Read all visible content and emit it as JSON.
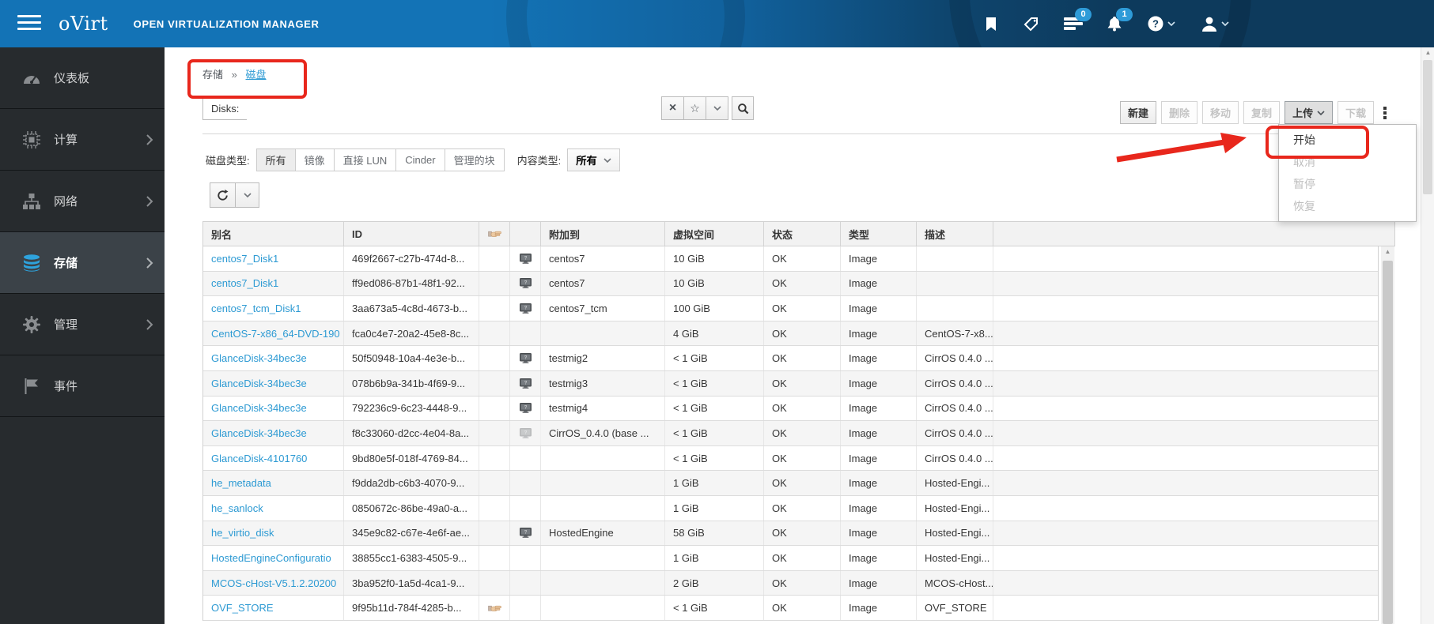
{
  "masthead": {
    "brand": "oVirt",
    "brand_suffix": "OPEN VIRTUALIZATION MANAGER",
    "tasks_badge": "0",
    "alerts_badge": "1"
  },
  "sidebar": {
    "items": [
      {
        "label": "仪表板",
        "icon": "dashboard",
        "chevron": false,
        "active": false
      },
      {
        "label": "计算",
        "icon": "cpu",
        "chevron": true,
        "active": false
      },
      {
        "label": "网络",
        "icon": "network",
        "chevron": true,
        "active": false
      },
      {
        "label": "存储",
        "icon": "storage",
        "chevron": true,
        "active": true
      },
      {
        "label": "管理",
        "icon": "gear",
        "chevron": true,
        "active": false
      },
      {
        "label": "事件",
        "icon": "flag",
        "chevron": false,
        "active": false
      }
    ]
  },
  "breadcrumb": {
    "parent": "存储",
    "separator": "»",
    "current": "磁盘"
  },
  "search": {
    "label": "Disks:",
    "value": ""
  },
  "actions": {
    "new": "新建",
    "remove": "删除",
    "move": "移动",
    "copy": "复制",
    "upload": "上传",
    "download": "下载"
  },
  "upload_menu": {
    "items": [
      {
        "label": "开始",
        "enabled": true
      },
      {
        "label": "取消",
        "enabled": false
      },
      {
        "label": "暂停",
        "enabled": false
      },
      {
        "label": "恢复",
        "enabled": false
      }
    ]
  },
  "filters": {
    "disk_type_label": "磁盘类型:",
    "disk_types": [
      "所有",
      "镜像",
      "直接 LUN",
      "Cinder",
      "管理的块"
    ],
    "active_disk_type": "所有",
    "content_type_label": "内容类型:",
    "content_type_value": "所有"
  },
  "table": {
    "headers": {
      "alias": "别名",
      "id": "ID",
      "attached_to": "附加到",
      "virtual_size": "虚拟空间",
      "status": "状态",
      "type": "类型",
      "description": "描述"
    },
    "rows": [
      {
        "alias": "centos7_Disk1",
        "id": "469f2667-c27b-474d-8...",
        "shareable": false,
        "vm_icon": "vm",
        "attached_to": "centos7",
        "virtual_size": "10 GiB",
        "status": "OK",
        "type": "Image",
        "description": ""
      },
      {
        "alias": "centos7_Disk1",
        "id": "ff9ed086-87b1-48f1-92...",
        "shareable": false,
        "vm_icon": "vm",
        "attached_to": "centos7",
        "virtual_size": "10 GiB",
        "status": "OK",
        "type": "Image",
        "description": ""
      },
      {
        "alias": "centos7_tcm_Disk1",
        "id": "3aa673a5-4c8d-4673-b...",
        "shareable": false,
        "vm_icon": "vm",
        "attached_to": "centos7_tcm",
        "virtual_size": "100 GiB",
        "status": "OK",
        "type": "Image",
        "description": ""
      },
      {
        "alias": "CentOS-7-x86_64-DVD-190",
        "id": "fca0c4e7-20a2-45e8-8c...",
        "shareable": false,
        "vm_icon": "",
        "attached_to": "",
        "virtual_size": "4 GiB",
        "status": "OK",
        "type": "Image",
        "description": "CentOS-7-x8..."
      },
      {
        "alias": "GlanceDisk-34bec3e",
        "id": "50f50948-10a4-4e3e-b...",
        "shareable": false,
        "vm_icon": "vm",
        "attached_to": "testmig2",
        "virtual_size": "< 1 GiB",
        "status": "OK",
        "type": "Image",
        "description": "CirrOS 0.4.0 ..."
      },
      {
        "alias": "GlanceDisk-34bec3e",
        "id": "078b6b9a-341b-4f69-9...",
        "shareable": false,
        "vm_icon": "vm",
        "attached_to": "testmig3",
        "virtual_size": "< 1 GiB",
        "status": "OK",
        "type": "Image",
        "description": "CirrOS 0.4.0 ..."
      },
      {
        "alias": "GlanceDisk-34bec3e",
        "id": "792236c9-6c23-4448-9...",
        "shareable": false,
        "vm_icon": "vm",
        "attached_to": "testmig4",
        "virtual_size": "< 1 GiB",
        "status": "OK",
        "type": "Image",
        "description": "CirrOS 0.4.0 ..."
      },
      {
        "alias": "GlanceDisk-34bec3e",
        "id": "f8c33060-d2cc-4e04-8a...",
        "shareable": false,
        "vm_icon": "template",
        "attached_to": "CirrOS_0.4.0 (base ...",
        "virtual_size": "< 1 GiB",
        "status": "OK",
        "type": "Image",
        "description": "CirrOS 0.4.0 ..."
      },
      {
        "alias": "GlanceDisk-4101760",
        "id": "9bd80e5f-018f-4769-84...",
        "shareable": false,
        "vm_icon": "",
        "attached_to": "",
        "virtual_size": "< 1 GiB",
        "status": "OK",
        "type": "Image",
        "description": "CirrOS 0.4.0 ..."
      },
      {
        "alias": "he_metadata",
        "id": "f9dda2db-c6b3-4070-9...",
        "shareable": false,
        "vm_icon": "",
        "attached_to": "",
        "virtual_size": "1 GiB",
        "status": "OK",
        "type": "Image",
        "description": "Hosted-Engi..."
      },
      {
        "alias": "he_sanlock",
        "id": "0850672c-86be-49a0-a...",
        "shareable": false,
        "vm_icon": "",
        "attached_to": "",
        "virtual_size": "1 GiB",
        "status": "OK",
        "type": "Image",
        "description": "Hosted-Engi..."
      },
      {
        "alias": "he_virtio_disk",
        "id": "345e9c82-c67e-4e6f-ae...",
        "shareable": false,
        "vm_icon": "vm",
        "attached_to": "HostedEngine",
        "virtual_size": "58 GiB",
        "status": "OK",
        "type": "Image",
        "description": "Hosted-Engi..."
      },
      {
        "alias": "HostedEngineConfiguratio",
        "id": "38855cc1-6383-4505-9...",
        "shareable": false,
        "vm_icon": "",
        "attached_to": "",
        "virtual_size": "1 GiB",
        "status": "OK",
        "type": "Image",
        "description": "Hosted-Engi..."
      },
      {
        "alias": "MCOS-cHost-V5.1.2.20200",
        "id": "3ba952f0-1a5d-4ca1-9...",
        "shareable": false,
        "vm_icon": "",
        "attached_to": "",
        "virtual_size": "2 GiB",
        "status": "OK",
        "type": "Image",
        "description": "MCOS-cHost..."
      },
      {
        "alias": "OVF_STORE",
        "id": "9f95b11d-784f-4285-b...",
        "shareable": true,
        "vm_icon": "",
        "attached_to": "",
        "virtual_size": "< 1 GiB",
        "status": "OK",
        "type": "Image",
        "description": "OVF_STORE"
      }
    ]
  }
}
